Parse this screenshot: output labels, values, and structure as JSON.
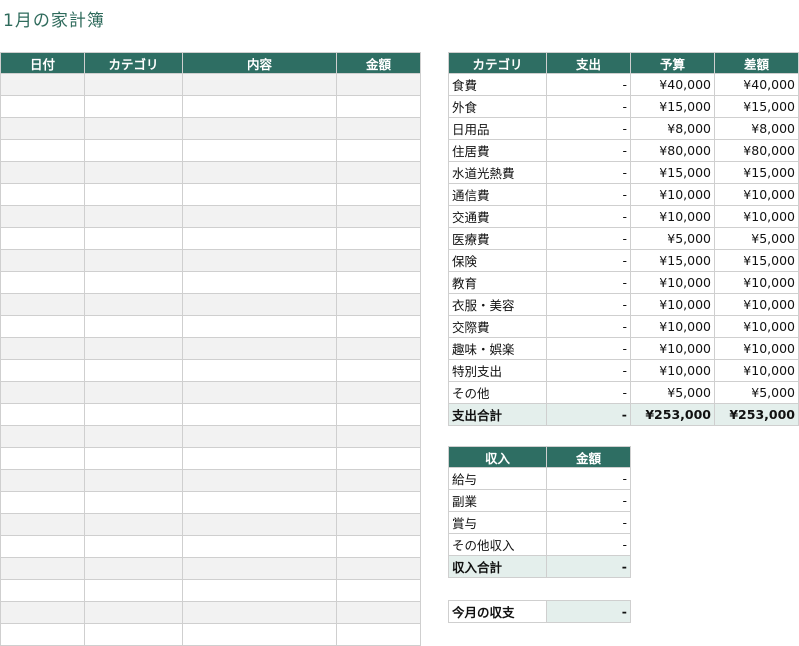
{
  "title": "1月の家計簿",
  "ledger": {
    "headers": [
      "日付",
      "カテゴリ",
      "内容",
      "金額"
    ],
    "row_count": 26
  },
  "budget": {
    "headers": [
      "カテゴリ",
      "支出",
      "予算",
      "差額"
    ],
    "rows": [
      {
        "category": "食費",
        "spent": "-",
        "budget": "¥40,000",
        "diff": "¥40,000"
      },
      {
        "category": "外食",
        "spent": "-",
        "budget": "¥15,000",
        "diff": "¥15,000"
      },
      {
        "category": "日用品",
        "spent": "-",
        "budget": "¥8,000",
        "diff": "¥8,000"
      },
      {
        "category": "住居費",
        "spent": "-",
        "budget": "¥80,000",
        "diff": "¥80,000"
      },
      {
        "category": "水道光熱費",
        "spent": "-",
        "budget": "¥15,000",
        "diff": "¥15,000"
      },
      {
        "category": "通信費",
        "spent": "-",
        "budget": "¥10,000",
        "diff": "¥10,000"
      },
      {
        "category": "交通費",
        "spent": "-",
        "budget": "¥10,000",
        "diff": "¥10,000"
      },
      {
        "category": "医療費",
        "spent": "-",
        "budget": "¥5,000",
        "diff": "¥5,000"
      },
      {
        "category": "保険",
        "spent": "-",
        "budget": "¥15,000",
        "diff": "¥15,000"
      },
      {
        "category": "教育",
        "spent": "-",
        "budget": "¥10,000",
        "diff": "¥10,000"
      },
      {
        "category": "衣服・美容",
        "spent": "-",
        "budget": "¥10,000",
        "diff": "¥10,000"
      },
      {
        "category": "交際費",
        "spent": "-",
        "budget": "¥10,000",
        "diff": "¥10,000"
      },
      {
        "category": "趣味・娯楽",
        "spent": "-",
        "budget": "¥10,000",
        "diff": "¥10,000"
      },
      {
        "category": "特別支出",
        "spent": "-",
        "budget": "¥10,000",
        "diff": "¥10,000"
      },
      {
        "category": "その他",
        "spent": "-",
        "budget": "¥5,000",
        "diff": "¥5,000"
      }
    ],
    "total": {
      "label": "支出合計",
      "spent": "-",
      "budget": "¥253,000",
      "diff": "¥253,000"
    }
  },
  "income": {
    "headers": [
      "収入",
      "金額"
    ],
    "rows": [
      {
        "label": "給与",
        "amount": "-"
      },
      {
        "label": "副業",
        "amount": "-"
      },
      {
        "label": "賞与",
        "amount": "-"
      },
      {
        "label": "その他収入",
        "amount": "-"
      }
    ],
    "total": {
      "label": "収入合計",
      "amount": "-"
    }
  },
  "balance": {
    "label": "今月の収支",
    "amount": "-"
  },
  "colors": {
    "header_bg": "#2e6e63",
    "title": "#2f6b5c",
    "total_bg": "#e4efec",
    "stripe": "#f2f2f2"
  }
}
